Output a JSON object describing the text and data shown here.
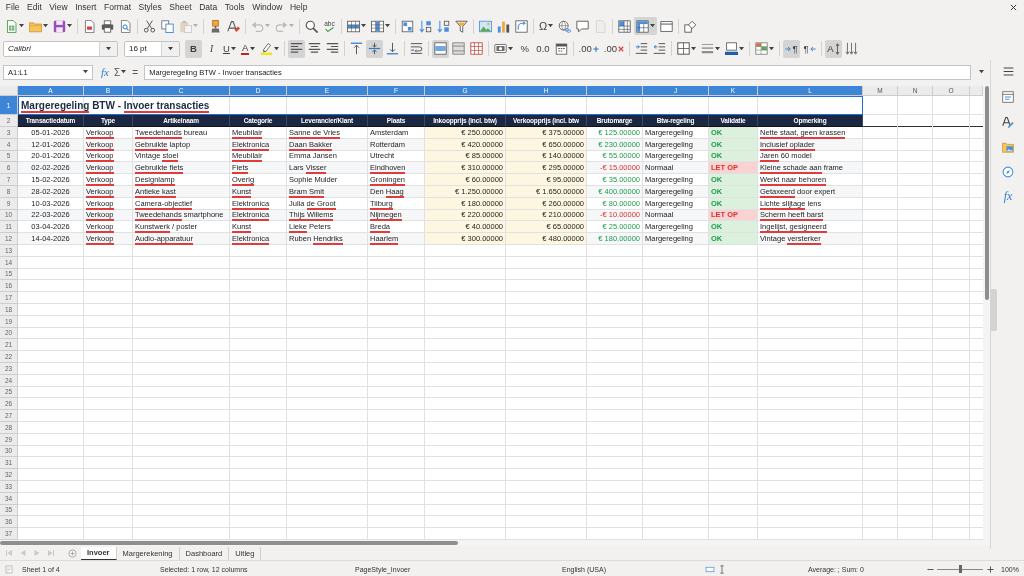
{
  "menu_bar": {
    "items": [
      "File",
      "Edit",
      "View",
      "Insert",
      "Format",
      "Styles",
      "Sheet",
      "Data",
      "Tools",
      "Window",
      "Help"
    ]
  },
  "standard_toolbar": [
    {
      "kind": "new",
      "pressed": false,
      "disabled": false
    },
    {
      "kind": "open",
      "pressed": false,
      "disabled": false
    },
    {
      "kind": "save",
      "pressed": false,
      "disabled": false
    },
    {
      "kind": "pdf",
      "pressed": false,
      "disabled": false
    },
    {
      "kind": "print",
      "pressed": false,
      "disabled": false
    },
    {
      "kind": "preview",
      "pressed": false,
      "disabled": false
    },
    {
      "kind": "cut",
      "pressed": false,
      "disabled": false
    },
    {
      "kind": "copy",
      "pressed": false,
      "disabled": false
    },
    {
      "kind": "paste",
      "pressed": false,
      "disabled": true
    },
    {
      "kind": "clone",
      "pressed": false,
      "disabled": false
    },
    {
      "kind": "clear",
      "pressed": false,
      "disabled": false
    },
    {
      "kind": "undo",
      "pressed": false,
      "disabled": true
    },
    {
      "kind": "redo",
      "pressed": false,
      "disabled": true
    },
    {
      "kind": "find",
      "pressed": false,
      "disabled": false
    },
    {
      "kind": "spelling",
      "label": "abc",
      "pressed": false,
      "disabled": false
    },
    {
      "kind": "row",
      "pressed": false,
      "disabled": false
    },
    {
      "kind": "column",
      "pressed": false,
      "disabled": false
    },
    {
      "kind": "sort",
      "pressed": false,
      "disabled": false
    },
    {
      "kind": "sort_asc",
      "pressed": false,
      "disabled": false
    },
    {
      "kind": "sort_desc",
      "pressed": false,
      "disabled": false
    },
    {
      "kind": "autofilter",
      "pressed": false,
      "disabled": false
    },
    {
      "kind": "image",
      "pressed": false,
      "disabled": false
    },
    {
      "kind": "chart",
      "pressed": false,
      "disabled": false
    },
    {
      "kind": "pivot",
      "pressed": false,
      "disabled": false
    },
    {
      "kind": "special",
      "label": "Ω",
      "pressed": false,
      "disabled": false
    },
    {
      "kind": "hyperlink",
      "pressed": false,
      "disabled": false
    },
    {
      "kind": "comment",
      "pressed": false,
      "disabled": false
    },
    {
      "kind": "header",
      "pressed": false,
      "disabled": true
    },
    {
      "kind": "freeze",
      "pressed": false,
      "disabled": false
    },
    {
      "kind": "split",
      "pressed": true,
      "disabled": false
    },
    {
      "kind": "window",
      "pressed": false,
      "disabled": false
    },
    {
      "kind": "shapes",
      "pressed": false,
      "disabled": false
    }
  ],
  "formatting_toolbar": {
    "font_name": "Calibri",
    "font_size": "16 pt",
    "tools": [
      {
        "kind": "bold",
        "label": "B",
        "pressed": true
      },
      {
        "kind": "italic",
        "label": "I",
        "pressed": false
      },
      {
        "kind": "underline",
        "label": "U",
        "pressed": false
      },
      {
        "kind": "font_color",
        "label": "A",
        "pressed": false
      },
      {
        "kind": "highlight",
        "pressed": false
      },
      {
        "kind": "align_left",
        "pressed": true
      },
      {
        "kind": "align_center",
        "pressed": false
      },
      {
        "kind": "align_right",
        "pressed": false
      },
      {
        "kind": "align_top",
        "pressed": false
      },
      {
        "kind": "align_middle",
        "pressed": true
      },
      {
        "kind": "align_bottom",
        "pressed": false
      },
      {
        "kind": "wrap",
        "pressed": false
      },
      {
        "kind": "merge_center",
        "pressed": true
      },
      {
        "kind": "merge",
        "pressed": false
      },
      {
        "kind": "unmerge",
        "pressed": false
      },
      {
        "kind": "currency",
        "pressed": false
      },
      {
        "kind": "percent",
        "label": "%",
        "pressed": false
      },
      {
        "kind": "number",
        "label": "0.0",
        "pressed": false
      },
      {
        "kind": "date",
        "pressed": false
      },
      {
        "kind": "add_decimal",
        "label": ".00",
        "pressed": false
      },
      {
        "kind": "delete_decimal",
        "label": ".00",
        "pressed": false
      },
      {
        "kind": "indent",
        "pressed": false
      },
      {
        "kind": "outdent",
        "pressed": false
      },
      {
        "kind": "borders",
        "pressed": false
      },
      {
        "kind": "border_style",
        "pressed": false
      },
      {
        "kind": "border_color",
        "pressed": false
      },
      {
        "kind": "conditional",
        "pressed": false
      },
      {
        "kind": "ltr",
        "label": "¶",
        "pressed": true
      },
      {
        "kind": "rtl",
        "label": "¶",
        "pressed": false
      },
      {
        "kind": "orientation",
        "label": "A",
        "pressed": true
      },
      {
        "kind": "stacked",
        "pressed": false
      }
    ]
  },
  "formula_bar": {
    "name_box": "A1:L1",
    "function_wizard": "fx",
    "sum": "Σ",
    "equals": "=",
    "value": "Margeregeling BTW - Invoer transacties"
  },
  "sheet": {
    "columns": [
      {
        "label": "A",
        "selected": true
      },
      {
        "label": "B",
        "selected": true
      },
      {
        "label": "C",
        "selected": true
      },
      {
        "label": "D",
        "selected": true
      },
      {
        "label": "E",
        "selected": true
      },
      {
        "label": "F",
        "selected": true
      },
      {
        "label": "G",
        "selected": true
      },
      {
        "label": "H",
        "selected": true
      },
      {
        "label": "I",
        "selected": true
      },
      {
        "label": "J",
        "selected": true
      },
      {
        "label": "K",
        "selected": true
      },
      {
        "label": "L",
        "selected": true
      },
      {
        "label": "M",
        "selected": false
      },
      {
        "label": "N",
        "selected": false
      },
      {
        "label": "O",
        "selected": false
      }
    ],
    "rows": [
      {
        "label": "1",
        "selected": true
      },
      {
        "label": "2",
        "selected": false
      },
      {
        "label": "3",
        "selected": false
      },
      {
        "label": "4",
        "selected": false
      },
      {
        "label": "5",
        "selected": false
      },
      {
        "label": "6",
        "selected": false
      },
      {
        "label": "7",
        "selected": false
      },
      {
        "label": "8",
        "selected": false
      },
      {
        "label": "9",
        "selected": false
      },
      {
        "label": "10",
        "selected": false
      },
      {
        "label": "11",
        "selected": false
      },
      {
        "label": "12",
        "selected": false
      },
      {
        "label": "13",
        "selected": false
      },
      {
        "label": "14",
        "selected": false
      },
      {
        "label": "15",
        "selected": false
      },
      {
        "label": "16",
        "selected": false
      },
      {
        "label": "17",
        "selected": false
      },
      {
        "label": "18",
        "selected": false
      },
      {
        "label": "19",
        "selected": false
      },
      {
        "label": "20",
        "selected": false
      },
      {
        "label": "21",
        "selected": false
      },
      {
        "label": "22",
        "selected": false
      },
      {
        "label": "23",
        "selected": false
      },
      {
        "label": "24",
        "selected": false
      },
      {
        "label": "25",
        "selected": false
      },
      {
        "label": "26",
        "selected": false
      },
      {
        "label": "27",
        "selected": false
      },
      {
        "label": "28",
        "selected": false
      },
      {
        "label": "29",
        "selected": false
      },
      {
        "label": "30",
        "selected": false
      },
      {
        "label": "31",
        "selected": false
      },
      {
        "label": "32",
        "selected": false
      },
      {
        "label": "33",
        "selected": false
      },
      {
        "label": "34",
        "selected": false
      },
      {
        "label": "35",
        "selected": false
      },
      {
        "label": "36",
        "selected": false
      },
      {
        "label": "37",
        "selected": false
      }
    ],
    "title": [
      {
        "text": "Margeregeling",
        "misspelled": true
      },
      {
        "text": " BTW - ",
        "misspelled": false
      },
      {
        "text": "Invoer transacties",
        "misspelled": true
      }
    ],
    "headers": [
      "Transactiedatum",
      "Type",
      "Artikelnaam",
      "Categorie",
      "Leverancier/Klant",
      "Plaats",
      "Inkoopprijs (incl. btw)",
      "Verkoopprijs (incl. btw",
      "Brutomarge",
      "Btw-regeling",
      "Validatie",
      "Opmerking"
    ],
    "records": [
      {
        "date": "05-01-2026",
        "type": [
          {
            "text": "Verkoop",
            "misspelled": true
          }
        ],
        "article": [
          {
            "text": "Tweedehands",
            "misspelled": true
          },
          {
            "text": " bureau",
            "misspelled": false
          }
        ],
        "category": [
          {
            "text": "Meubilair",
            "misspelled": true
          }
        ],
        "party": [
          {
            "text": "Sanne de Vries",
            "misspelled": true
          }
        ],
        "place": "Amsterdam",
        "purchase": "€ 250.00000",
        "sale": "€ 375.00000",
        "margin": {
          "text": "€ 125.00000",
          "kind": "gain"
        },
        "scheme": "Margeregeling",
        "validation": {
          "text": "OK",
          "kind": "ok"
        },
        "note": [
          {
            "text": "Nette staat, geen krassen",
            "misspelled": true
          }
        ]
      },
      {
        "date": "12-01-2026",
        "type": [
          {
            "text": "Verkoop",
            "misspelled": true
          }
        ],
        "article": [
          {
            "text": "Gebruikte",
            "misspelled": true
          },
          {
            "text": " laptop",
            "misspelled": false
          }
        ],
        "category": [
          {
            "text": "Elektronica",
            "misspelled": true
          }
        ],
        "party": [
          {
            "text": "Daan Bakker",
            "misspelled": true
          }
        ],
        "place": "Rotterdam",
        "purchase": "€ 420.00000",
        "sale": "€ 650.00000",
        "margin": {
          "text": "€ 230.00000",
          "kind": "gain"
        },
        "scheme": "Margeregeling",
        "validation": {
          "text": "OK",
          "kind": "ok"
        },
        "note": [
          {
            "text": "Inclusief oplader",
            "misspelled": true
          }
        ]
      },
      {
        "date": "20-01-2026",
        "type": [
          {
            "text": "Verkoop",
            "misspelled": true
          }
        ],
        "article": [
          {
            "text": "Vintage ",
            "misspelled": false
          },
          {
            "text": "stoel",
            "misspelled": true
          }
        ],
        "category": [
          {
            "text": "Meubilair",
            "misspelled": true
          }
        ],
        "party": "Emma Jansen",
        "place": "Utrecht",
        "purchase": "€ 85.00000",
        "sale": "€ 140.00000",
        "margin": {
          "text": "€ 55.00000",
          "kind": "gain"
        },
        "scheme": "Margeregeling",
        "validation": {
          "text": "OK",
          "kind": "ok"
        },
        "note": [
          {
            "text": "Jaren",
            "misspelled": true
          },
          {
            "text": " 60 model",
            "misspelled": false
          }
        ]
      },
      {
        "date": "02-02-2026",
        "type": [
          {
            "text": "Verkoop",
            "misspelled": true
          }
        ],
        "article": [
          {
            "text": "Gebruikte fiets",
            "misspelled": true
          }
        ],
        "category": [
          {
            "text": "Fiets",
            "misspelled": true
          }
        ],
        "party": [
          {
            "text": "Lars ",
            "misspelled": false
          },
          {
            "text": "Visser",
            "misspelled": true
          }
        ],
        "place": [
          {
            "text": "Eindhoven",
            "misspelled": true
          }
        ],
        "purchase": "€ 310.00000",
        "sale": "€ 295.00000",
        "margin": {
          "text": "-€ 15.00000",
          "kind": "loss"
        },
        "scheme": "Normaal",
        "validation": {
          "text": "LET OP",
          "kind": "warning"
        },
        "note": [
          {
            "text": "Kleine schade aan",
            "misspelled": true
          },
          {
            "text": " frame",
            "misspelled": false
          }
        ]
      },
      {
        "date": "15-02-2026",
        "type": [
          {
            "text": "Verkoop",
            "misspelled": true
          }
        ],
        "article": [
          {
            "text": "Designlamp",
            "misspelled": true
          }
        ],
        "category": [
          {
            "text": "Overig",
            "misspelled": true
          }
        ],
        "party": "Sophie Mulder",
        "place": [
          {
            "text": "Groningen",
            "misspelled": true
          }
        ],
        "purchase": "€ 60.00000",
        "sale": "€ 95.00000",
        "margin": {
          "text": "€ 35.00000",
          "kind": "gain"
        },
        "scheme": "Margeregeling",
        "validation": {
          "text": "OK",
          "kind": "ok"
        },
        "note": [
          {
            "text": "Werkt naar behoren",
            "misspelled": true
          }
        ]
      },
      {
        "date": "28-02-2026",
        "type": [
          {
            "text": "Verkoop",
            "misspelled": true
          }
        ],
        "article": [
          {
            "text": "Antieke kast",
            "misspelled": true
          }
        ],
        "category": [
          {
            "text": "Kunst",
            "misspelled": true
          }
        ],
        "party": [
          {
            "text": "Bram Smit",
            "misspelled": true
          }
        ],
        "place": [
          {
            "text": "Den ",
            "misspelled": false
          },
          {
            "text": "Haag",
            "misspelled": true
          }
        ],
        "purchase": "€ 1.250.00000",
        "sale": "€ 1.650.00000",
        "margin": {
          "text": "€ 400.00000",
          "kind": "gain"
        },
        "scheme": "Margeregeling",
        "validation": {
          "text": "OK",
          "kind": "ok"
        },
        "note": [
          {
            "text": "Getaxeerd",
            "misspelled": true
          },
          {
            "text": " door expert",
            "misspelled": false
          }
        ]
      },
      {
        "date": "10-03-2026",
        "type": [
          {
            "text": "Verkoop",
            "misspelled": true
          }
        ],
        "article": [
          {
            "text": "Camera-objectief",
            "misspelled": true
          }
        ],
        "category": [
          {
            "text": "Elektronica",
            "misspelled": true
          }
        ],
        "party": [
          {
            "text": "Julia ",
            "misspelled": false
          },
          {
            "text": "de Groot",
            "misspelled": true
          }
        ],
        "place": [
          {
            "text": "Tilburg",
            "misspelled": true
          }
        ],
        "purchase": "€ 180.00000",
        "sale": "€ 260.00000",
        "margin": {
          "text": "€ 80.00000",
          "kind": "gain"
        },
        "scheme": "Margeregeling",
        "validation": {
          "text": "OK",
          "kind": "ok"
        },
        "note": [
          {
            "text": "Lichte slijtage",
            "misspelled": true
          },
          {
            "text": " lens",
            "misspelled": false
          }
        ]
      },
      {
        "date": "22-03-2026",
        "type": [
          {
            "text": "Verkoop",
            "misspelled": true
          }
        ],
        "article": [
          {
            "text": "Tweedehands",
            "misspelled": true
          },
          {
            "text": " smartphone",
            "misspelled": false
          }
        ],
        "category": [
          {
            "text": "Elektronica",
            "misspelled": true
          }
        ],
        "party": [
          {
            "text": "Thijs Willems",
            "misspelled": true
          }
        ],
        "place": [
          {
            "text": "Nijmegen",
            "misspelled": true
          }
        ],
        "purchase": "€ 220.00000",
        "sale": "€ 210.00000",
        "margin": {
          "text": "-€ 10.00000",
          "kind": "loss"
        },
        "scheme": "Normaal",
        "validation": {
          "text": "LET OP",
          "kind": "warning"
        },
        "note": [
          {
            "text": "Scherm heeft barst",
            "misspelled": true
          }
        ]
      },
      {
        "date": "03-04-2026",
        "type": [
          {
            "text": "Verkoop",
            "misspelled": true
          }
        ],
        "article": [
          {
            "text": "Kunstwerk",
            "misspelled": true
          },
          {
            "text": " / poster",
            "misspelled": false
          }
        ],
        "category": [
          {
            "text": "Kunst",
            "misspelled": true
          }
        ],
        "party": [
          {
            "text": "Lieke",
            "misspelled": true
          },
          {
            "text": " Peters",
            "misspelled": false
          }
        ],
        "place": [
          {
            "text": "Breda",
            "misspelled": true
          }
        ],
        "purchase": "€ 40.00000",
        "sale": "€ 65.00000",
        "margin": {
          "text": "€ 25.00000",
          "kind": "gain"
        },
        "scheme": "Margeregeling",
        "validation": {
          "text": "OK",
          "kind": "ok"
        },
        "note": [
          {
            "text": "Ingelijst, gesigneerd",
            "misspelled": true
          }
        ]
      },
      {
        "date": "14-04-2026",
        "type": [
          {
            "text": "Verkoop",
            "misspelled": true
          }
        ],
        "article": [
          {
            "text": "Audio-apparatuur",
            "misspelled": true
          }
        ],
        "category": [
          {
            "text": "Elektronica",
            "misspelled": true
          }
        ],
        "party": [
          {
            "text": "Ruben ",
            "misspelled": false
          },
          {
            "text": "Hendriks",
            "misspelled": true
          }
        ],
        "place": [
          {
            "text": "Haarlem",
            "misspelled": true
          }
        ],
        "purchase": "€ 300.00000",
        "sale": "€ 480.00000",
        "margin": {
          "text": "€ 180.00000",
          "kind": "gain"
        },
        "scheme": "Margeregeling",
        "validation": {
          "text": "OK",
          "kind": "ok"
        },
        "note": [
          {
            "text": "Vintage ",
            "misspelled": false
          },
          {
            "text": "versterker",
            "misspelled": true
          }
        ]
      }
    ]
  },
  "sidebar": {
    "tabs": [
      {
        "kind": "properties"
      },
      {
        "kind": "styles"
      },
      {
        "kind": "gallery"
      },
      {
        "kind": "navigator"
      },
      {
        "kind": "functions",
        "label": "fx"
      }
    ]
  },
  "sheet_tabs": {
    "scroll_buttons_disabled": true,
    "tabs": [
      {
        "label": "Invoer",
        "selected": true
      },
      {
        "label": "Margerekening",
        "selected": false
      },
      {
        "label": "Dashboard",
        "selected": false
      },
      {
        "label": "Uitleg",
        "selected": false
      }
    ]
  },
  "status_bar": {
    "sheet": "Sheet 1 of 4",
    "selection": "Selected: 1 row, 12 columns",
    "page_style": "PageStyle_Invoer",
    "language": "English (USA)",
    "statistics": "Average: ; Sum: 0",
    "zoom": {
      "level": 0.5,
      "reading": "100%"
    }
  }
}
